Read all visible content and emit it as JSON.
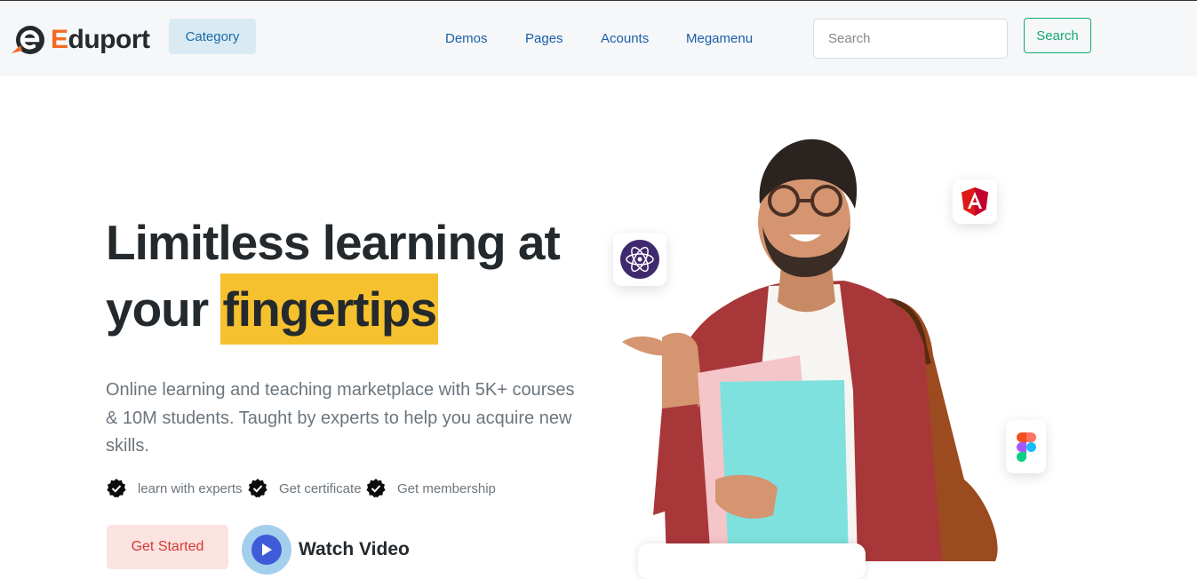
{
  "header": {
    "brand_prefix": "E",
    "brand_rest": "duport",
    "category_label": "Category",
    "nav": [
      "Demos",
      "Pages",
      "Acounts",
      "Megamenu"
    ],
    "search_placeholder": "Search",
    "search_button": "Search"
  },
  "hero": {
    "headline_line1": "Limitless learning at",
    "headline_line2_prefix": "your ",
    "headline_highlight": "fingertips",
    "lead": "Online learning and teaching marketplace with 5K+ courses & 10M students. Taught by experts to help you acquire new skills.",
    "features": [
      "learn with experts",
      "Get certificate",
      "Get membership"
    ],
    "get_started": "Get Started",
    "watch_video": "Watch Video"
  },
  "floating_icons": [
    "atom-icon",
    "angular-icon",
    "figma-icon"
  ],
  "colors": {
    "brand_accent": "#f36b22",
    "highlight": "#f6c12e",
    "nav_blue": "#1a5fa8",
    "search_green": "#17a96e",
    "get_started_bg": "#fbe3e2",
    "get_started_text": "#d43a32"
  }
}
